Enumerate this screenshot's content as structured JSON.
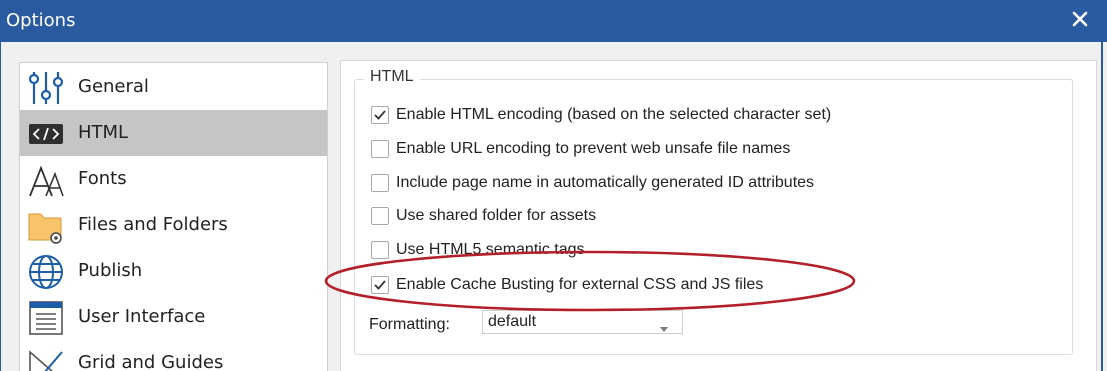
{
  "window": {
    "title": "Options"
  },
  "sidebar": {
    "items": [
      {
        "label": "General",
        "icon": "sliders-icon"
      },
      {
        "label": "HTML",
        "icon": "code-icon",
        "selected": true
      },
      {
        "label": "Fonts",
        "icon": "font-icon"
      },
      {
        "label": "Files and Folders",
        "icon": "folder-gear-icon"
      },
      {
        "label": "Publish",
        "icon": "globe-icon"
      },
      {
        "label": "User Interface",
        "icon": "window-icon"
      },
      {
        "label": "Grid and Guides",
        "icon": "ruler-icon"
      }
    ]
  },
  "html_group": {
    "label": "HTML",
    "options": [
      {
        "label": "Enable HTML encoding (based on the selected character set)",
        "checked": true
      },
      {
        "label": "Enable URL encoding to prevent web unsafe file names",
        "checked": false
      },
      {
        "label": "Include page name in automatically generated ID attributes",
        "checked": false
      },
      {
        "label": "Use shared folder for assets",
        "checked": false
      },
      {
        "label": "Use HTML5 semantic tags",
        "checked": false
      },
      {
        "label": "Enable Cache Busting for external CSS and JS files",
        "checked": true
      }
    ],
    "formatting": {
      "label": "Formatting:",
      "value": "default"
    }
  },
  "colors": {
    "titlebar": "#2a5a9f",
    "selected_item": "#c5c5c5",
    "annotation": "#b3202a"
  }
}
